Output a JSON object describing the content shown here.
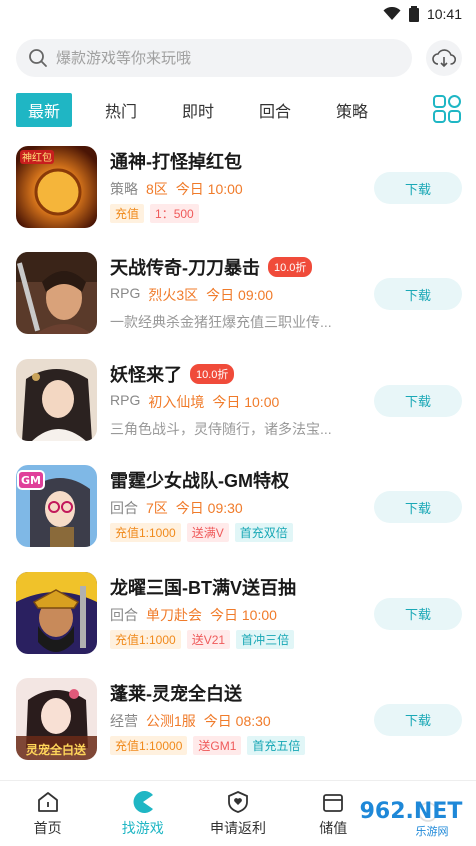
{
  "status": {
    "time": "10:41"
  },
  "search": {
    "placeholder": "爆款游戏等你来玩哦"
  },
  "tabs": [
    "最新",
    "热门",
    "即时",
    "回合",
    "策略"
  ],
  "games": [
    {
      "title": "通神-打怪掉红包",
      "genre": "策略",
      "server": "8区",
      "time": "今日 10:00",
      "tags": [
        {
          "text": "充值",
          "color": "orange"
        },
        {
          "text": "1：500",
          "color": "red"
        }
      ],
      "button": "下载"
    },
    {
      "title": "天战传奇-刀刀暴击",
      "discount": "10.0折",
      "genre": "RPG",
      "server": "烈火3区",
      "time": "今日 09:00",
      "desc": "一款经典杀金猪狂爆充值三职业传...",
      "button": "下载"
    },
    {
      "title": "妖怪来了",
      "discount": "10.0折",
      "genre": "RPG",
      "server": "初入仙境",
      "time": "今日 10:00",
      "desc": "三角色战斗，灵侍随行，诸多法宝...",
      "button": "下载"
    },
    {
      "title": "雷霆少女战队-GM特权",
      "genre": "回合",
      "server": "7区",
      "time": "今日 09:30",
      "tags": [
        {
          "text": "充值1:1000",
          "color": "orange"
        },
        {
          "text": "送满V",
          "color": "red"
        },
        {
          "text": "首充双倍",
          "color": "teal"
        }
      ],
      "button": "下载"
    },
    {
      "title": "龙曜三国-BT满V送百抽",
      "genre": "回合",
      "server": "单刀赴会",
      "time": "今日 10:00",
      "tags": [
        {
          "text": "充值1:1000",
          "color": "orange"
        },
        {
          "text": "送V21",
          "color": "red"
        },
        {
          "text": "首冲三倍",
          "color": "teal"
        }
      ],
      "button": "下载"
    },
    {
      "title": "蓬莱-灵宠全白送",
      "genre": "经营",
      "server": "公测1服",
      "time": "今日 08:30",
      "tags": [
        {
          "text": "充值1:10000",
          "color": "orange"
        },
        {
          "text": "送GM1",
          "color": "red"
        },
        {
          "text": "首充五倍",
          "color": "teal"
        }
      ],
      "button": "下载"
    }
  ],
  "thumb_labels": {
    "game1": "神红包",
    "game4": "GM",
    "game6": "灵宠全白送"
  },
  "nav": [
    "首页",
    "找游戏",
    "申请返利",
    "储值",
    ""
  ],
  "watermark": {
    "text": "962.NET",
    "sub": "乐游网"
  },
  "colors": {
    "accent": "#1fb6c4",
    "discount": "#f04b3a",
    "server": "#f07b2a"
  }
}
